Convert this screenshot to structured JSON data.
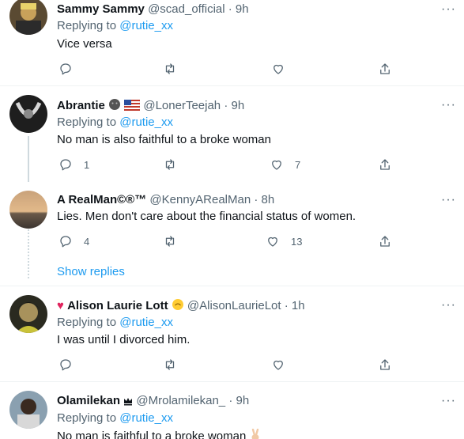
{
  "tweets": [
    {
      "name": "Sammy Sammy",
      "handle": "@scad_official",
      "dot": "·",
      "time": "9h",
      "reply_prefix": "Replying to",
      "reply_mention": "@rutie_xx",
      "text": "Vice versa",
      "replies": "",
      "likes": ""
    },
    {
      "name": "Abrantie",
      "handle": "@LonerTeejah",
      "dot": "·",
      "time": "9h",
      "reply_prefix": "Replying to",
      "reply_mention": "@rutie_xx",
      "text": "No man is also faithful to a broke woman",
      "replies": "1",
      "likes": "7"
    },
    {
      "name": "A RealMan©®™",
      "handle": "@KennyARealMan",
      "dot": "·",
      "time": "8h",
      "text": "Lies. Men don't care about the financial status of women.",
      "replies": "4",
      "likes": "13"
    },
    {
      "name_prefix": "♥",
      "name": "Alison Laurie Lott",
      "handle": "@AlisonLaurieLot",
      "dot": "·",
      "time": "1h",
      "reply_prefix": "Replying to",
      "reply_mention": "@rutie_xx",
      "text": "I was until I divorced him.",
      "replies": "",
      "likes": ""
    },
    {
      "name": "Olamilekan",
      "handle": "@Mrolamilekan_",
      "dot": "·",
      "time": "9h",
      "reply_prefix": "Replying to",
      "reply_mention": "@rutie_xx",
      "text": "No man is faithful to a broke woman"
    }
  ],
  "show_replies": "Show replies",
  "more_glyph": "···",
  "icons": [
    "reply-icon",
    "retweet-icon",
    "like-icon",
    "share-icon"
  ],
  "colors": {
    "link": "#1d9bf0",
    "muted": "#536471",
    "text": "#0f1419",
    "heart": "#e0245e"
  }
}
